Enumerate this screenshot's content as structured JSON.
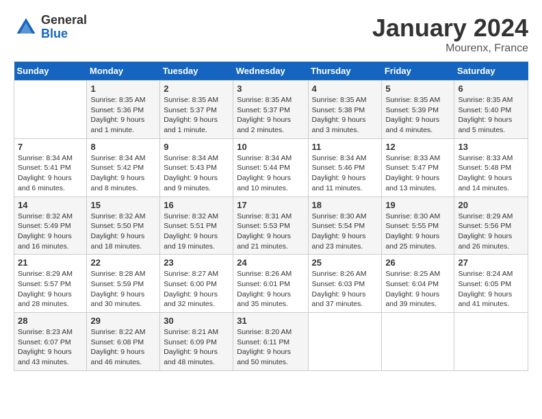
{
  "header": {
    "logo_general": "General",
    "logo_blue": "Blue",
    "month": "January 2024",
    "location": "Mourenx, France"
  },
  "days_of_week": [
    "Sunday",
    "Monday",
    "Tuesday",
    "Wednesday",
    "Thursday",
    "Friday",
    "Saturday"
  ],
  "weeks": [
    [
      {
        "day": "",
        "info": ""
      },
      {
        "day": "1",
        "info": "Sunrise: 8:35 AM\nSunset: 5:36 PM\nDaylight: 9 hours\nand 1 minute."
      },
      {
        "day": "2",
        "info": "Sunrise: 8:35 AM\nSunset: 5:37 PM\nDaylight: 9 hours\nand 1 minute."
      },
      {
        "day": "3",
        "info": "Sunrise: 8:35 AM\nSunset: 5:37 PM\nDaylight: 9 hours\nand 2 minutes."
      },
      {
        "day": "4",
        "info": "Sunrise: 8:35 AM\nSunset: 5:38 PM\nDaylight: 9 hours\nand 3 minutes."
      },
      {
        "day": "5",
        "info": "Sunrise: 8:35 AM\nSunset: 5:39 PM\nDaylight: 9 hours\nand 4 minutes."
      },
      {
        "day": "6",
        "info": "Sunrise: 8:35 AM\nSunset: 5:40 PM\nDaylight: 9 hours\nand 5 minutes."
      }
    ],
    [
      {
        "day": "7",
        "info": "Sunrise: 8:34 AM\nSunset: 5:41 PM\nDaylight: 9 hours\nand 6 minutes."
      },
      {
        "day": "8",
        "info": "Sunrise: 8:34 AM\nSunset: 5:42 PM\nDaylight: 9 hours\nand 8 minutes."
      },
      {
        "day": "9",
        "info": "Sunrise: 8:34 AM\nSunset: 5:43 PM\nDaylight: 9 hours\nand 9 minutes."
      },
      {
        "day": "10",
        "info": "Sunrise: 8:34 AM\nSunset: 5:44 PM\nDaylight: 9 hours\nand 10 minutes."
      },
      {
        "day": "11",
        "info": "Sunrise: 8:34 AM\nSunset: 5:46 PM\nDaylight: 9 hours\nand 11 minutes."
      },
      {
        "day": "12",
        "info": "Sunrise: 8:33 AM\nSunset: 5:47 PM\nDaylight: 9 hours\nand 13 minutes."
      },
      {
        "day": "13",
        "info": "Sunrise: 8:33 AM\nSunset: 5:48 PM\nDaylight: 9 hours\nand 14 minutes."
      }
    ],
    [
      {
        "day": "14",
        "info": "Sunrise: 8:32 AM\nSunset: 5:49 PM\nDaylight: 9 hours\nand 16 minutes."
      },
      {
        "day": "15",
        "info": "Sunrise: 8:32 AM\nSunset: 5:50 PM\nDaylight: 9 hours\nand 18 minutes."
      },
      {
        "day": "16",
        "info": "Sunrise: 8:32 AM\nSunset: 5:51 PM\nDaylight: 9 hours\nand 19 minutes."
      },
      {
        "day": "17",
        "info": "Sunrise: 8:31 AM\nSunset: 5:53 PM\nDaylight: 9 hours\nand 21 minutes."
      },
      {
        "day": "18",
        "info": "Sunrise: 8:30 AM\nSunset: 5:54 PM\nDaylight: 9 hours\nand 23 minutes."
      },
      {
        "day": "19",
        "info": "Sunrise: 8:30 AM\nSunset: 5:55 PM\nDaylight: 9 hours\nand 25 minutes."
      },
      {
        "day": "20",
        "info": "Sunrise: 8:29 AM\nSunset: 5:56 PM\nDaylight: 9 hours\nand 26 minutes."
      }
    ],
    [
      {
        "day": "21",
        "info": "Sunrise: 8:29 AM\nSunset: 5:57 PM\nDaylight: 9 hours\nand 28 minutes."
      },
      {
        "day": "22",
        "info": "Sunrise: 8:28 AM\nSunset: 5:59 PM\nDaylight: 9 hours\nand 30 minutes."
      },
      {
        "day": "23",
        "info": "Sunrise: 8:27 AM\nSunset: 6:00 PM\nDaylight: 9 hours\nand 32 minutes."
      },
      {
        "day": "24",
        "info": "Sunrise: 8:26 AM\nSunset: 6:01 PM\nDaylight: 9 hours\nand 35 minutes."
      },
      {
        "day": "25",
        "info": "Sunrise: 8:26 AM\nSunset: 6:03 PM\nDaylight: 9 hours\nand 37 minutes."
      },
      {
        "day": "26",
        "info": "Sunrise: 8:25 AM\nSunset: 6:04 PM\nDaylight: 9 hours\nand 39 minutes."
      },
      {
        "day": "27",
        "info": "Sunrise: 8:24 AM\nSunset: 6:05 PM\nDaylight: 9 hours\nand 41 minutes."
      }
    ],
    [
      {
        "day": "28",
        "info": "Sunrise: 8:23 AM\nSunset: 6:07 PM\nDaylight: 9 hours\nand 43 minutes."
      },
      {
        "day": "29",
        "info": "Sunrise: 8:22 AM\nSunset: 6:08 PM\nDaylight: 9 hours\nand 46 minutes."
      },
      {
        "day": "30",
        "info": "Sunrise: 8:21 AM\nSunset: 6:09 PM\nDaylight: 9 hours\nand 48 minutes."
      },
      {
        "day": "31",
        "info": "Sunrise: 8:20 AM\nSunset: 6:11 PM\nDaylight: 9 hours\nand 50 minutes."
      },
      {
        "day": "",
        "info": ""
      },
      {
        "day": "",
        "info": ""
      },
      {
        "day": "",
        "info": ""
      }
    ]
  ]
}
